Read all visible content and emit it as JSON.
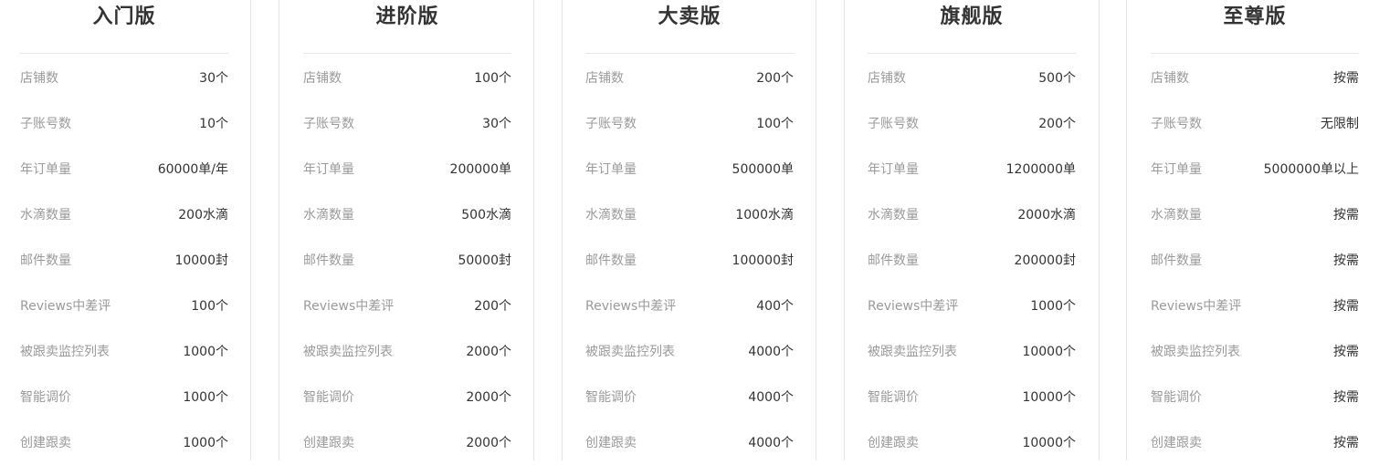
{
  "feature_labels": [
    "店铺数",
    "子账号数",
    "年订单量",
    "水滴数量",
    "邮件数量",
    "Reviews中差评",
    "被跟卖监控列表",
    "智能调价",
    "创建跟卖"
  ],
  "plans": [
    {
      "name": "入门版",
      "values": [
        "30个",
        "10个",
        "60000单/年",
        "200水滴",
        "10000封",
        "100个",
        "1000个",
        "1000个",
        "1000个"
      ]
    },
    {
      "name": "进阶版",
      "values": [
        "100个",
        "30个",
        "200000单",
        "500水滴",
        "50000封",
        "200个",
        "2000个",
        "2000个",
        "2000个"
      ]
    },
    {
      "name": "大卖版",
      "values": [
        "200个",
        "100个",
        "500000单",
        "1000水滴",
        "100000封",
        "400个",
        "4000个",
        "4000个",
        "4000个"
      ]
    },
    {
      "name": "旗舰版",
      "values": [
        "500个",
        "200个",
        "1200000单",
        "2000水滴",
        "200000封",
        "1000个",
        "10000个",
        "10000个",
        "10000个"
      ]
    },
    {
      "name": "至尊版",
      "values": [
        "按需",
        "无限制",
        "5000000单以上",
        "按需",
        "按需",
        "按需",
        "按需",
        "按需",
        "按需"
      ]
    }
  ]
}
